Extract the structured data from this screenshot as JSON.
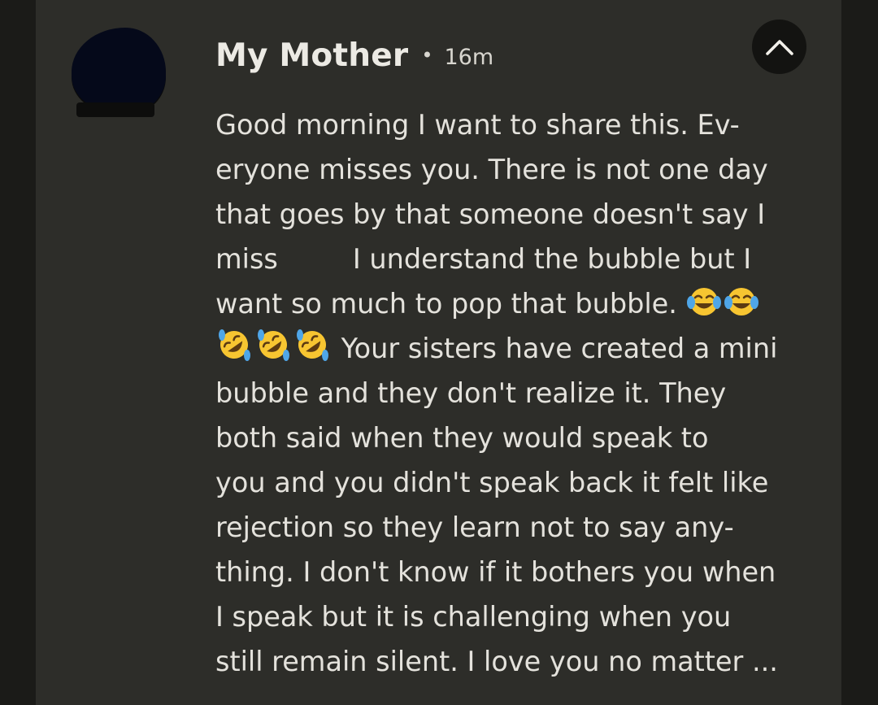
{
  "notification": {
    "sender": "My Mother",
    "separator": "•",
    "time": "16m",
    "collapse_icon": "chevron-up-icon",
    "message_lines": [
      "Good morning I want to share this. Ev-",
      "eryone misses you. There is not one day",
      "that goes by that someone doesn't say I",
      "miss",
      "I understand the bubble but I",
      "want so much to pop that bubble.",
      "Your sisters have created a mini",
      "bubble and they don't realize it. They",
      "both said when they would speak to",
      "you and you didn't speak back it felt like",
      "rejection so they learn not to say any-",
      "thing. I don't know if it bothers you when",
      "I speak but it is challenging when you",
      "still remain silent. I love you no matter ..."
    ],
    "emojis": {
      "laughing_tears": "face-with-tears-of-joy-icon",
      "rolling_laughing": "rolling-on-floor-laughing-icon"
    }
  },
  "colors": {
    "card_bg": "#2d2d29",
    "screen_bg": "#1b1b18",
    "text": "#e4e2dc",
    "button_bg": "#131311",
    "emoji_yellow": "#f7c531",
    "tear_blue": "#4fa6e8"
  }
}
